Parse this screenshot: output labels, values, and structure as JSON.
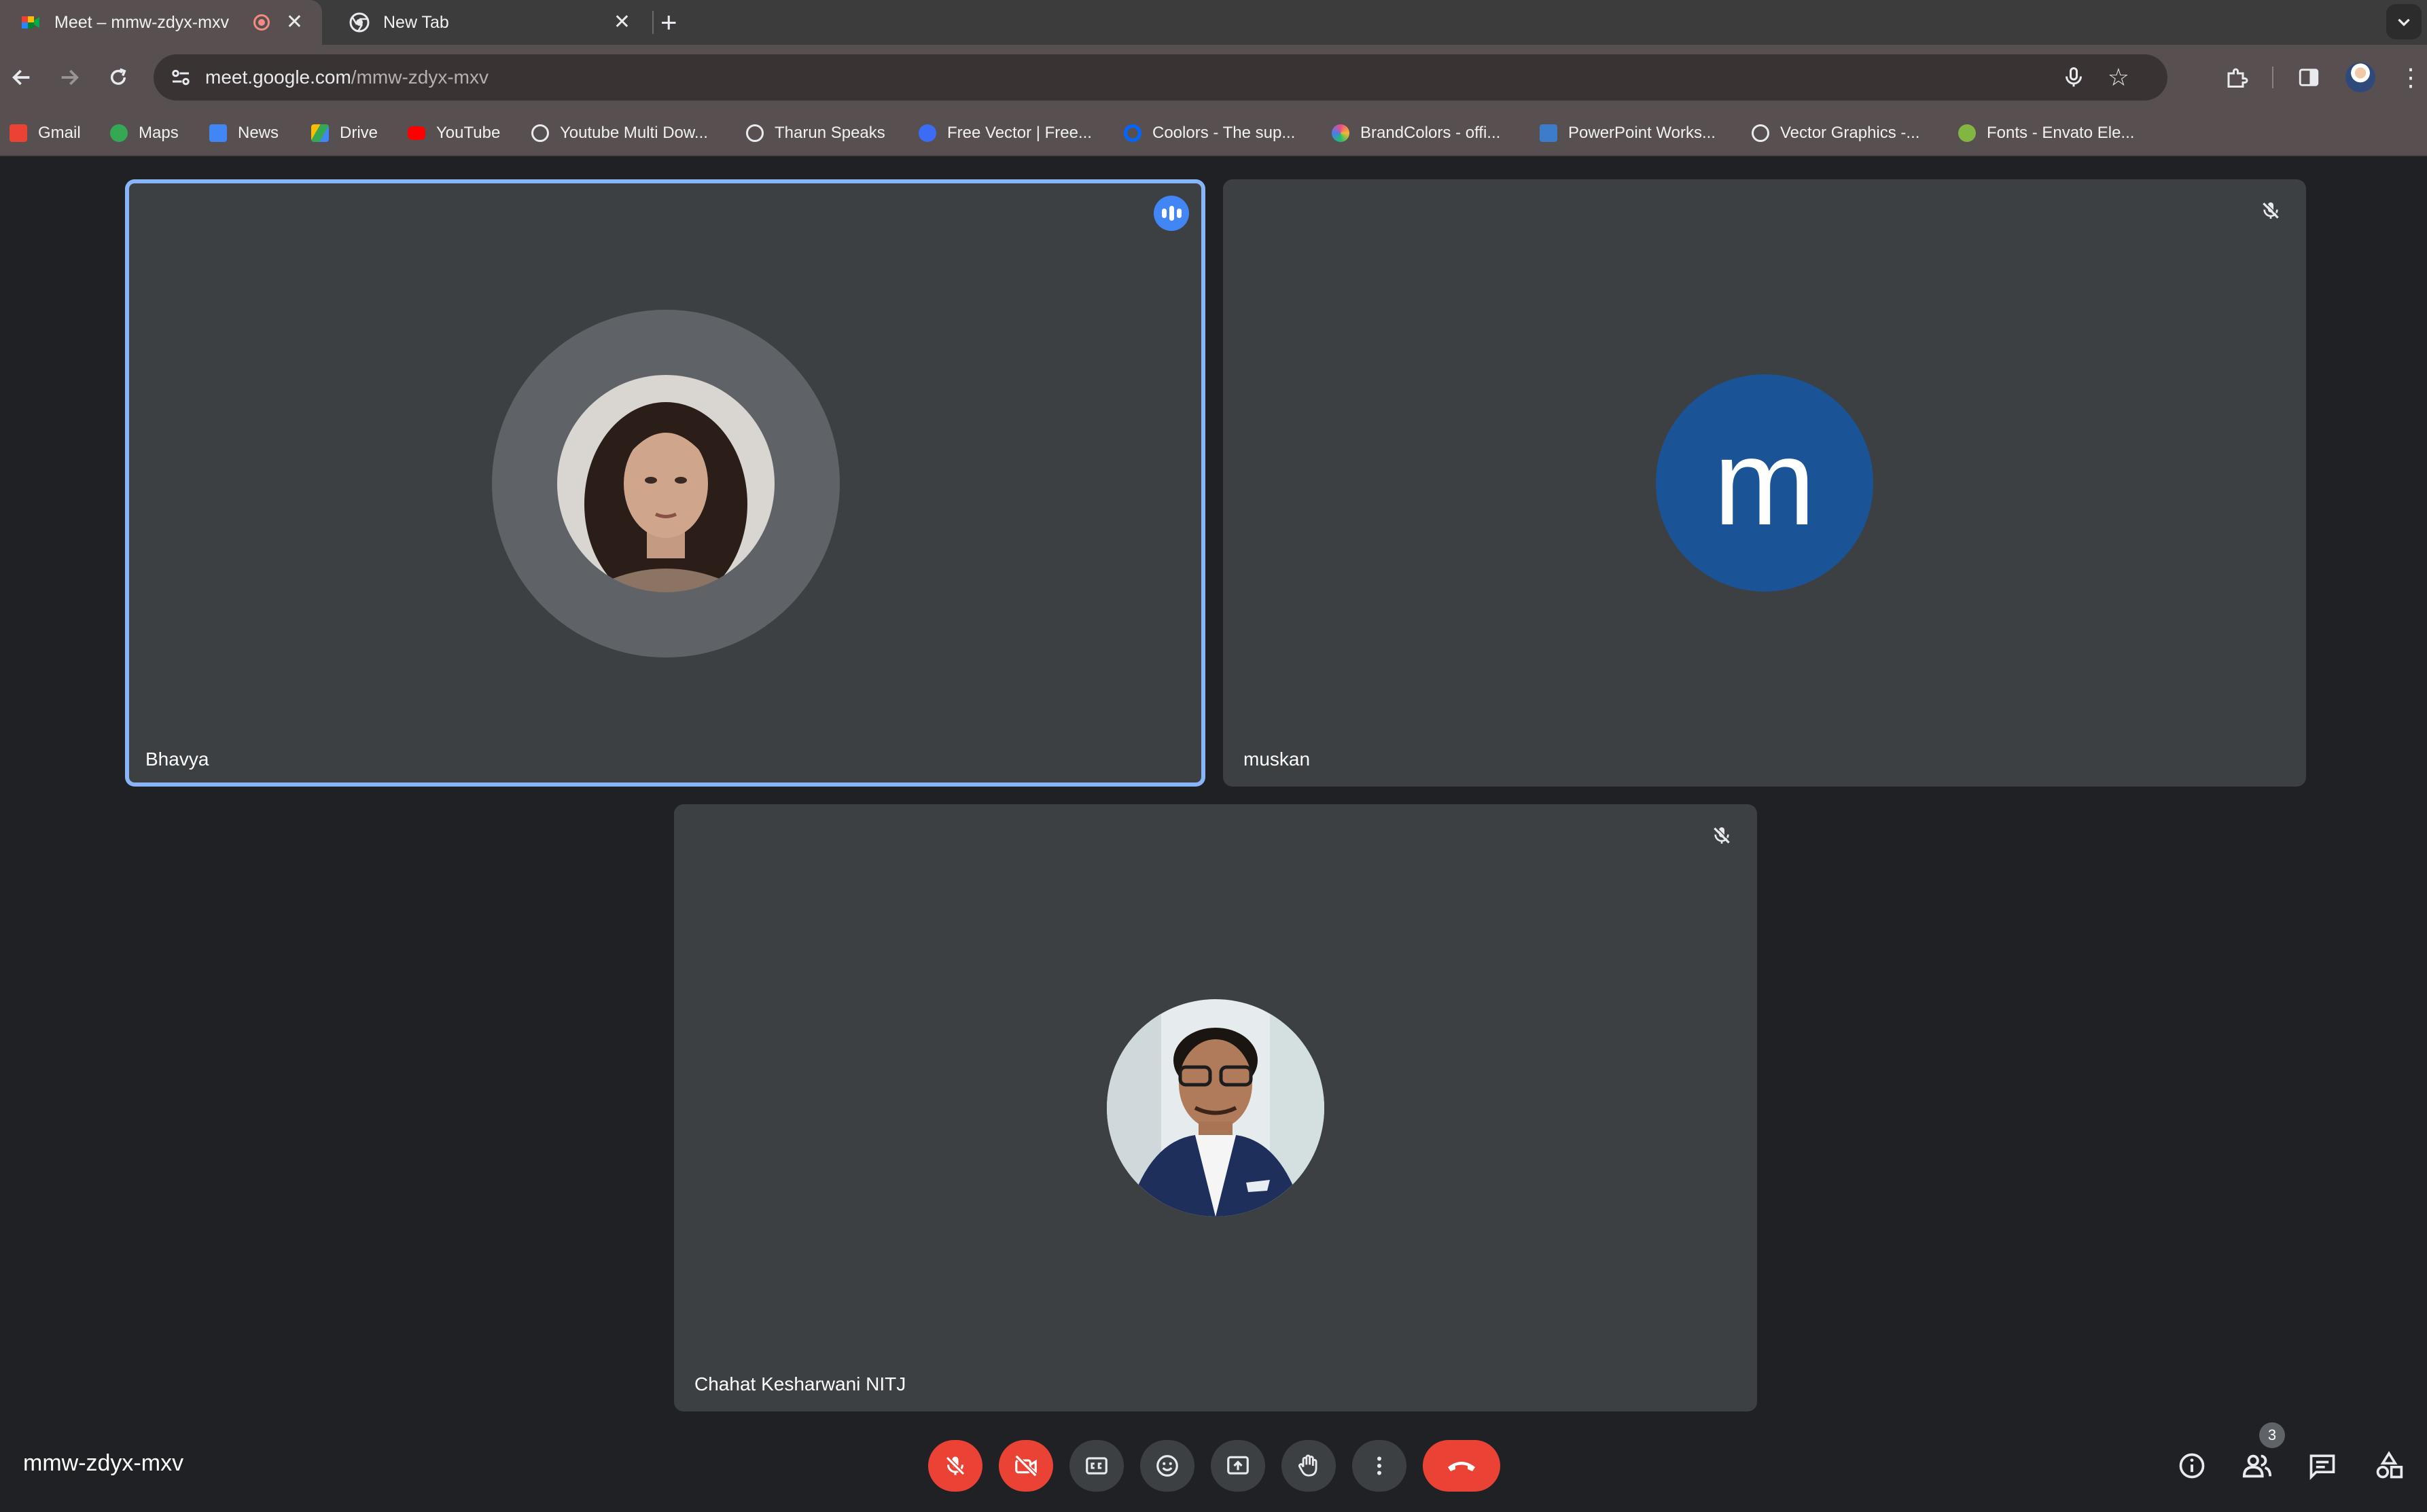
{
  "browser": {
    "tabs": [
      {
        "title": "Meet – mmw-zdyx-mxv",
        "active": true,
        "recording": true,
        "favicon": "google-meet-icon"
      },
      {
        "title": "New Tab",
        "active": false,
        "favicon": "chrome-icon"
      }
    ],
    "url": {
      "host": "meet.google.com",
      "path": "/mmw-zdyx-mxv"
    },
    "bookmarks": [
      {
        "label": "Gmail",
        "icon": "gmail-icon",
        "color": "#ea4335"
      },
      {
        "label": "Maps",
        "icon": "maps-icon",
        "color": "#34a853"
      },
      {
        "label": "News",
        "icon": "news-icon",
        "color": "#4285f4"
      },
      {
        "label": "Drive",
        "icon": "drive-icon",
        "color": "#fbbc04"
      },
      {
        "label": "YouTube",
        "icon": "youtube-icon",
        "color": "#ff0000"
      },
      {
        "label": "Youtube Multi Dow...",
        "icon": "globe-icon",
        "color": "#e8eaed"
      },
      {
        "label": "Tharun Speaks",
        "icon": "globe-icon",
        "color": "#e8eaed"
      },
      {
        "label": "Free Vector | Free...",
        "icon": "freepik-icon",
        "color": "#3b6cf6"
      },
      {
        "label": "Coolors - The sup...",
        "icon": "coolors-icon",
        "color": "#0066ff"
      },
      {
        "label": "BrandColors - offi...",
        "icon": "brandcolors-icon",
        "color": "#e94c89"
      },
      {
        "label": "PowerPoint Works...",
        "icon": "powerpoint-icon",
        "color": "#3d7cc9"
      },
      {
        "label": "Vector Graphics -...",
        "icon": "globe-icon",
        "color": "#e8eaed"
      },
      {
        "label": "Fonts - Envato Ele...",
        "icon": "envato-icon",
        "color": "#82b541"
      }
    ]
  },
  "meet": {
    "participants": [
      {
        "name": "Bhavya",
        "speaking": true,
        "muted": false,
        "avatar_type": "photo"
      },
      {
        "name": "muskan",
        "speaking": false,
        "muted": true,
        "avatar_type": "letter",
        "avatar_letter": "m",
        "avatar_color": "#1a5396"
      },
      {
        "name": "Chahat Kesharwani NITJ",
        "speaking": false,
        "muted": true,
        "avatar_type": "photo"
      }
    ],
    "meeting_code": "mmw-zdyx-mxv",
    "participant_count": "3",
    "accent": "#8ab4f8",
    "danger": "#ea4335"
  }
}
